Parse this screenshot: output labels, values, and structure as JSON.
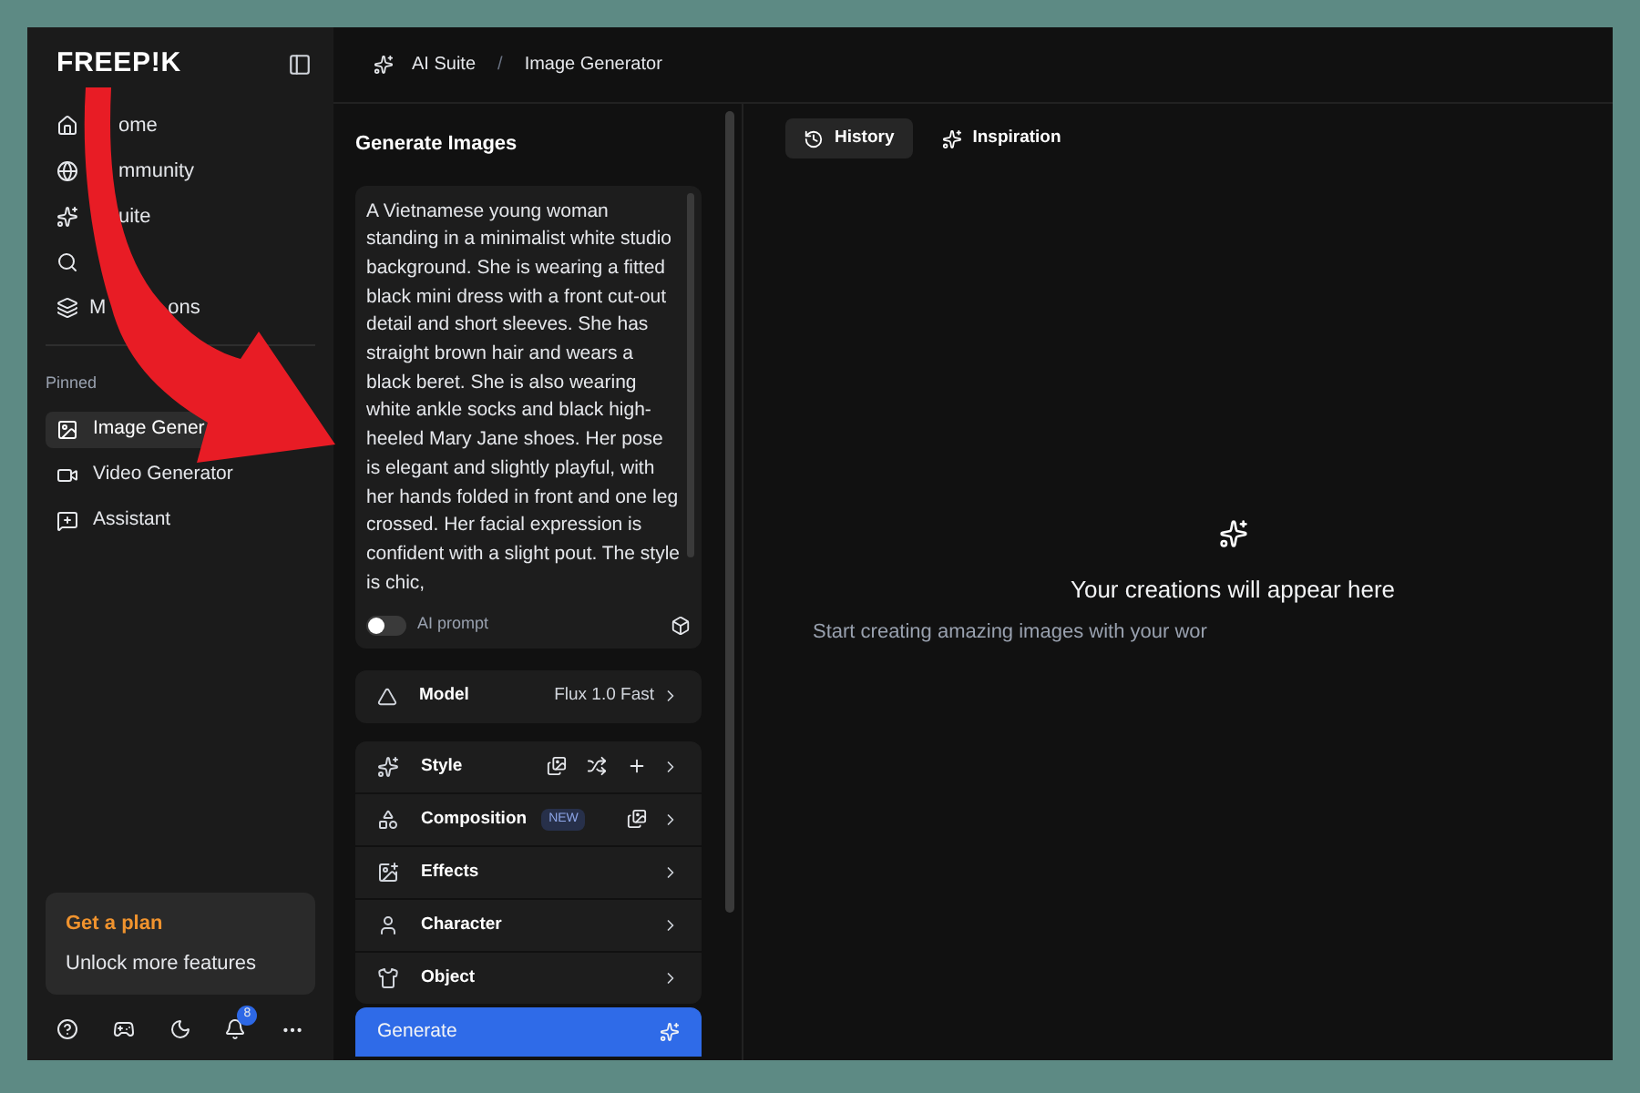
{
  "logo": "FREEP!K",
  "breadcrumb": [
    "AI Suite",
    "/",
    "Image Generator"
  ],
  "sidebar": {
    "nav": [
      {
        "kind": "labelled",
        "label_parts": [
          "ome"
        ]
      },
      {
        "kind": "labelled",
        "label_parts": [
          "mmunity"
        ]
      },
      {
        "kind": "labelled",
        "label_parts": [
          "uite"
        ]
      },
      {
        "kind": "icon_only"
      },
      {
        "kind": "labelled",
        "label_parts": [
          "M",
          "ons"
        ]
      }
    ],
    "pinned_heading": "Pinned",
    "pinned": [
      {
        "label": "Image Gener",
        "selected": true
      },
      {
        "label": "Video Generator",
        "selected": false
      },
      {
        "label": "Assistant",
        "selected": false
      }
    ],
    "plan": {
      "title": "Get a plan",
      "subtitle": "Unlock more features"
    },
    "notification_count": "8"
  },
  "panel": {
    "title": "Generate Images",
    "prompt": "A Vietnamese young woman standing in a minimalist white studio background. She is wearing a fitted black mini dress with a front cut-out detail and short sleeves. She has straight brown hair and wears a black beret. She is also wearing white ankle socks and black high-heeled Mary Jane shoes. Her pose is elegant and slightly playful, with her hands folded in front and one leg crossed. Her facial expression is confident with a slight pout. The style is chic,",
    "ai_prompt": {
      "label": "AI prompt",
      "on": false
    },
    "model": {
      "label": "Model",
      "value": "Flux 1.0 Fast"
    },
    "options": [
      {
        "kind": "style",
        "label": "Style"
      },
      {
        "kind": "composition",
        "label": "Composition",
        "badge": "NEW"
      },
      {
        "kind": "plain",
        "label": "Effects"
      },
      {
        "kind": "plain",
        "label": "Character"
      },
      {
        "kind": "plain",
        "label": "Object"
      }
    ],
    "generate": "Generate"
  },
  "tabs": [
    {
      "label": "History",
      "selected": true
    },
    {
      "label": "Inspiration",
      "selected": false
    }
  ],
  "empty_state": {
    "title": "Your creations will appear here",
    "subtitle": "Start creating amazing images with your wor"
  }
}
